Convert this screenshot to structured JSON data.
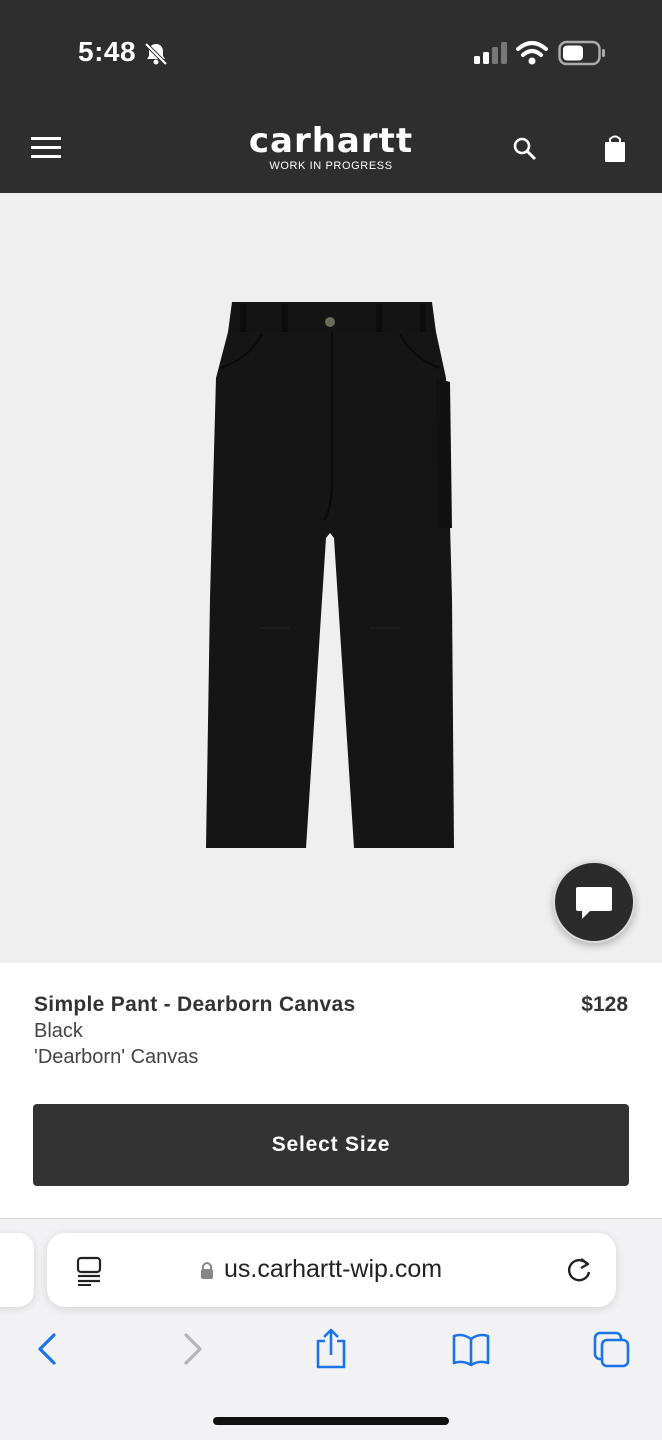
{
  "status_bar": {
    "time": "5:48"
  },
  "header": {
    "logo_main": "carhartt",
    "logo_sub": "WORK IN PROGRESS"
  },
  "product": {
    "name": "Simple Pant - Dearborn Canvas",
    "price": "$128",
    "color": "Black",
    "material": "'Dearborn' Canvas",
    "select_size_label": "Select Size"
  },
  "browser": {
    "url": "us.carhartt-wip.com"
  },
  "colors": {
    "header_bg": "#2e2e2e",
    "image_bg": "#efefef",
    "button_bg": "#333333",
    "safari_accent": "#1a73e8"
  }
}
